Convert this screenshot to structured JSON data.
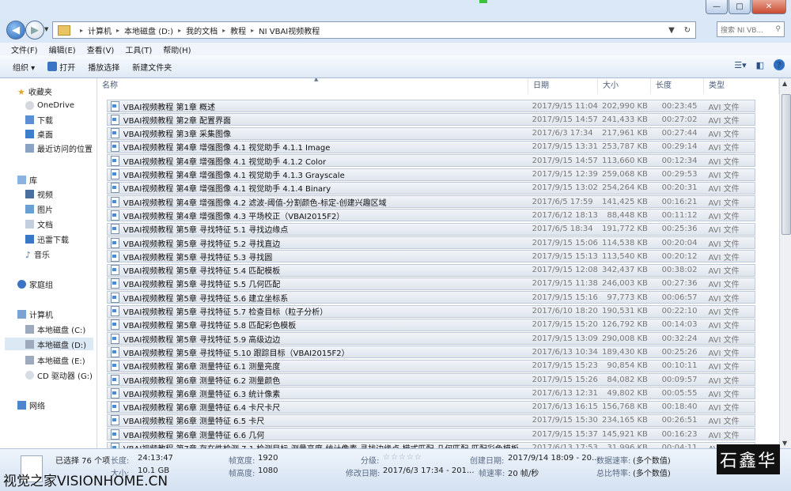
{
  "window": {
    "min_label": "—",
    "max_label": "□",
    "close_label": "✕"
  },
  "address": {
    "crumbs": [
      "计算机",
      "本地磁盘 (D:)",
      "我的文档",
      "教程",
      "NI VBAI视频教程"
    ],
    "search_placeholder": "搜索 NI VB..."
  },
  "menu": [
    "文件(F)",
    "编辑(E)",
    "查看(V)",
    "工具(T)",
    "帮助(H)"
  ],
  "toolbar": {
    "organize": "组织 ▾",
    "open": "打开",
    "play_selection": "播放选择",
    "new_folder": "新建文件夹"
  },
  "nav": {
    "favorites": "收藏夹",
    "onedrive": "OneDrive",
    "downloads": "下载",
    "desktop": "桌面",
    "recent": "最近访问的位置",
    "libraries": "库",
    "videos": "视频",
    "pictures": "图片",
    "documents": "文档",
    "thunder": "迅雷下载",
    "music": "音乐",
    "homegroup": "家庭组",
    "computer": "计算机",
    "drive_c": "本地磁盘 (C:)",
    "drive_d": "本地磁盘 (D:)",
    "drive_e": "本地磁盘 (E:)",
    "drive_g": "CD 驱动器 (G:)",
    "network": "网络"
  },
  "columns": {
    "name": "名称",
    "date": "日期",
    "size": "大小",
    "length": "长度",
    "type": "类型"
  },
  "files": [
    {
      "name": "VBAI视频教程 第1章 概述",
      "date": "2017/9/15 11:04",
      "size": "202,990 KB",
      "length": "00:23:45",
      "type": "AVI 文件"
    },
    {
      "name": "VBAI视频教程 第2章 配置界面",
      "date": "2017/9/15 14:57",
      "size": "241,433 KB",
      "length": "00:27:02",
      "type": "AVI 文件"
    },
    {
      "name": "VBAI视频教程 第3章 采集图像",
      "date": "2017/6/3 17:34",
      "size": "217,961 KB",
      "length": "00:27:44",
      "type": "AVI 文件"
    },
    {
      "name": "VBAI视频教程 第4章 增强图像 4.1 视觉助手 4.1.1 Image",
      "date": "2017/9/15 13:31",
      "size": "253,787 KB",
      "length": "00:29:14",
      "type": "AVI 文件"
    },
    {
      "name": "VBAI视频教程 第4章 增强图像 4.1 视觉助手 4.1.2 Color",
      "date": "2017/9/15 14:57",
      "size": "113,660 KB",
      "length": "00:12:34",
      "type": "AVI 文件"
    },
    {
      "name": "VBAI视频教程 第4章 增强图像 4.1 视觉助手 4.1.3 Grayscale",
      "date": "2017/9/15 12:39",
      "size": "259,068 KB",
      "length": "00:29:53",
      "type": "AVI 文件"
    },
    {
      "name": "VBAI视频教程 第4章 增强图像 4.1 视觉助手 4.1.4 Binary",
      "date": "2017/9/15 13:02",
      "size": "254,264 KB",
      "length": "00:20:31",
      "type": "AVI 文件"
    },
    {
      "name": "VBAI视频教程 第4章 增强图像 4.2 滤波-阈值-分割颜色-标定-创建兴趣区域",
      "date": "2017/6/5 17:59",
      "size": "141,425 KB",
      "length": "00:16:21",
      "type": "AVI 文件"
    },
    {
      "name": "VBAI视频教程 第4章 增强图像 4.3 平场校正（VBAI2015F2）",
      "date": "2017/6/12 18:13",
      "size": "88,448 KB",
      "length": "00:11:12",
      "type": "AVI 文件"
    },
    {
      "name": "VBAI视频教程 第5章 寻找特征 5.1 寻找边缘点",
      "date": "2017/6/5 18:34",
      "size": "191,772 KB",
      "length": "00:25:36",
      "type": "AVI 文件"
    },
    {
      "name": "VBAI视频教程 第5章 寻找特征 5.2 寻找直边",
      "date": "2017/9/15 15:06",
      "size": "114,538 KB",
      "length": "00:20:04",
      "type": "AVI 文件"
    },
    {
      "name": "VBAI视频教程 第5章 寻找特征 5.3 寻找圆",
      "date": "2017/9/15 15:13",
      "size": "113,540 KB",
      "length": "00:20:12",
      "type": "AVI 文件"
    },
    {
      "name": "VBAI视频教程 第5章 寻找特征 5.4 匹配模板",
      "date": "2017/9/15 12:08",
      "size": "342,437 KB",
      "length": "00:38:02",
      "type": "AVI 文件"
    },
    {
      "name": "VBAI视频教程 第5章 寻找特征 5.5 几何匹配",
      "date": "2017/9/15 11:38",
      "size": "246,003 KB",
      "length": "00:27:36",
      "type": "AVI 文件"
    },
    {
      "name": "VBAI视频教程 第5章 寻找特征 5.6 建立坐标系",
      "date": "2017/9/15 15:16",
      "size": "97,773 KB",
      "length": "00:06:57",
      "type": "AVI 文件"
    },
    {
      "name": "VBAI视频教程 第5章 寻找特征 5.7 检查目标（粒子分析）",
      "date": "2017/6/10 18:20",
      "size": "190,531 KB",
      "length": "00:22:10",
      "type": "AVI 文件"
    },
    {
      "name": "VBAI视频教程 第5章 寻找特征 5.8 匹配彩色模板",
      "date": "2017/9/15 15:20",
      "size": "126,792 KB",
      "length": "00:14:03",
      "type": "AVI 文件"
    },
    {
      "name": "VBAI视频教程 第5章 寻找特征 5.9 高级边边",
      "date": "2017/9/15 13:09",
      "size": "290,008 KB",
      "length": "00:32:24",
      "type": "AVI 文件"
    },
    {
      "name": "VBAI视频教程 第5章 寻找特征 5.10 跟踪目标（VBAI2015F2）",
      "date": "2017/6/13 10:34",
      "size": "189,430 KB",
      "length": "00:25:26",
      "type": "AVI 文件"
    },
    {
      "name": "VBAI视频教程 第6章 测量特征 6.1 测量亮度",
      "date": "2017/9/15 15:23",
      "size": "90,854 KB",
      "length": "00:10:11",
      "type": "AVI 文件"
    },
    {
      "name": "VBAI视频教程 第6章 测量特征 6.2 测量颜色",
      "date": "2017/9/15 15:26",
      "size": "84,082 KB",
      "length": "00:09:57",
      "type": "AVI 文件"
    },
    {
      "name": "VBAI视频教程 第6章 测量特征 6.3 统计像素",
      "date": "2017/6/13 12:31",
      "size": "49,802 KB",
      "length": "00:05:55",
      "type": "AVI 文件"
    },
    {
      "name": "VBAI视频教程 第6章 测量特征 6.4 卡尺卡尺",
      "date": "2017/6/13 16:15",
      "size": "156,768 KB",
      "length": "00:18:40",
      "type": "AVI 文件"
    },
    {
      "name": "VBAI视频教程 第6章 测量特征 6.5 卡尺",
      "date": "2017/9/15 15:30",
      "size": "234,165 KB",
      "length": "00:26:51",
      "type": "AVI 文件"
    },
    {
      "name": "VBAI视频教程 第6章 测量特征 6.6 几何",
      "date": "2017/9/15 15:37",
      "size": "145,921 KB",
      "length": "00:16:23",
      "type": "AVI 文件"
    },
    {
      "name": "VBAI视频教程 第7章 存在性检测 7.1 检测目标-测量亮度-统计像素-寻找边缘点-模式匹配-几何匹配-匹配彩色模板",
      "date": "2017/6/13 17:53",
      "size": "31,996 KB",
      "length": "00:04:11",
      "type": "AVI 文件"
    }
  ],
  "details": {
    "selected": "已选择 76 个项",
    "length_label": "长度:",
    "length_value": "24:13:47",
    "size_label": "大小:",
    "size_value": "10.1 GB",
    "frame_width_label": "帧宽度:",
    "frame_width_value": "1920",
    "frame_height_label": "帧高度:",
    "frame_height_value": "1080",
    "rating_label": "分级:",
    "rating_stars": "☆☆☆☆☆",
    "modified_label": "修改日期:",
    "modified_value": "2017/6/3 17:34 - 201...",
    "created_label": "创建日期:",
    "created_value": "2017/9/14 18:09 - 20...",
    "framerate_label": "帧速率:",
    "framerate_value": "20 帧/秒",
    "datarate_label": "数据速率:",
    "datarate_value": "(多个数值)",
    "totalrate_label": "总比特率:",
    "totalrate_value": "(多个数值)"
  },
  "watermark_left": "视觉之家VISIONHOME.CN",
  "watermark_right": "石鑫华"
}
